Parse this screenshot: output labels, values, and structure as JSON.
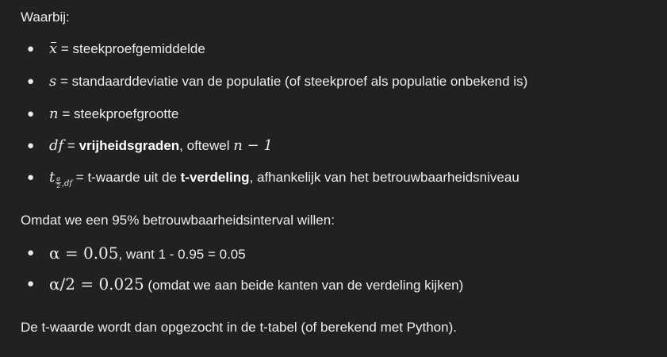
{
  "intro": "Waarbij:",
  "defs": {
    "xbar": {
      "symbol": "x",
      "text": " = steekproefgemiddelde"
    },
    "s": {
      "symbol": "s",
      "text": " = standaarddeviatie van de populatie (of steekproef als populatie onbekend is)"
    },
    "n": {
      "symbol": "n",
      "text": " = steekproefgrootte"
    },
    "df": {
      "symbol": "df",
      "text_pre": " = ",
      "bold": "vrijheidsgraden",
      "text_post": ", oftewel ",
      "expr": "n − 1"
    },
    "t": {
      "symbol": "t",
      "sub_num": "α",
      "sub_den": "2",
      "sub_rest": ",df",
      "text_pre": " = t-waarde uit de ",
      "bold": "t-verdeling",
      "text_post": ", afhankelijk van het betrouwbaarheidsniveau"
    }
  },
  "para2": "Omdat we een 95% betrouwbaarheidsinterval willen:",
  "alpha": {
    "item1": {
      "expr": "α = 0.05",
      "text": ", want 1 - 0.95 = 0.05"
    },
    "item2": {
      "expr": "α/2 = 0.025",
      "text": " (omdat we aan beide kanten van de verdeling kijken)"
    }
  },
  "para3": "De t-waarde wordt dan opgezocht in de t-tabel (of berekend met Python)."
}
